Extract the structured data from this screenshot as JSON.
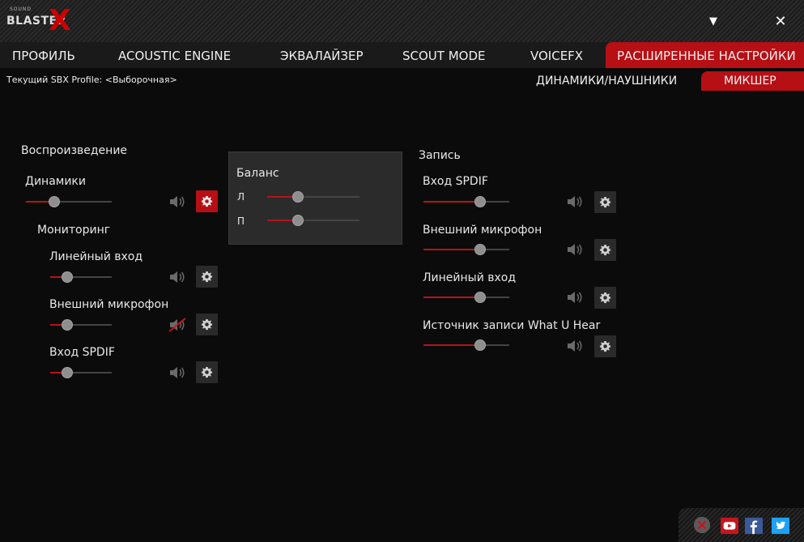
{
  "app": {
    "logo_sub": "SOUND",
    "logo_main": "BLASTER",
    "logo_x": "X"
  },
  "window": {
    "dropdown_glyph": "▼",
    "close_glyph": "✕"
  },
  "nav": {
    "items": [
      {
        "label": "ПРОФИЛЬ"
      },
      {
        "label": "ACOUSTIC ENGINE"
      },
      {
        "label": "ЭКВАЛАЙЗЕР"
      },
      {
        "label": "SCOUT MODE"
      },
      {
        "label": "VOICEFX"
      },
      {
        "label": "РАСШИРЕННЫЕ НАСТРОЙКИ",
        "active": true
      }
    ]
  },
  "profile": {
    "label": "Текущий SBX Profile: <Выборочная>"
  },
  "subtabs": [
    {
      "label": "ДИНАМИКИ/НАУШНИКИ"
    },
    {
      "label": "МИКШЕР",
      "active": true
    }
  ],
  "playback": {
    "title": "Воспроизведение",
    "speakers": {
      "label": "Динамики",
      "level": 0.33,
      "muted": false
    },
    "monitoring": {
      "title": "Мониторинг",
      "channels": [
        {
          "label": "Линейный вход",
          "level": 0.28,
          "muted": false
        },
        {
          "label": "Внешний микрофон",
          "level": 0.28,
          "muted": true
        },
        {
          "label": "Вход SPDIF",
          "level": 0.28,
          "muted": false
        }
      ]
    }
  },
  "balance": {
    "title": "Баланс",
    "left_label": "Л",
    "right_label": "П",
    "left_level": 0.33,
    "right_level": 0.33
  },
  "recording": {
    "title": "Запись",
    "channels": [
      {
        "label": "Вход SPDIF",
        "level": 0.66,
        "muted": false
      },
      {
        "label": "Внешний микрофон",
        "level": 0.66,
        "muted": false
      },
      {
        "label": "Линейный вход",
        "level": 0.66,
        "muted": false
      },
      {
        "label": "Источник записи What U Hear",
        "level": 0.66,
        "muted": false
      }
    ]
  },
  "colors": {
    "accent": "#b60f14",
    "knob": "#8e8e8e",
    "track": "#444444"
  },
  "icons": [
    "speaker-icon",
    "muted-speaker-icon",
    "gear-icon",
    "close-icon",
    "youtube-icon",
    "facebook-icon",
    "twitter-icon",
    "dropdown-icon"
  ]
}
